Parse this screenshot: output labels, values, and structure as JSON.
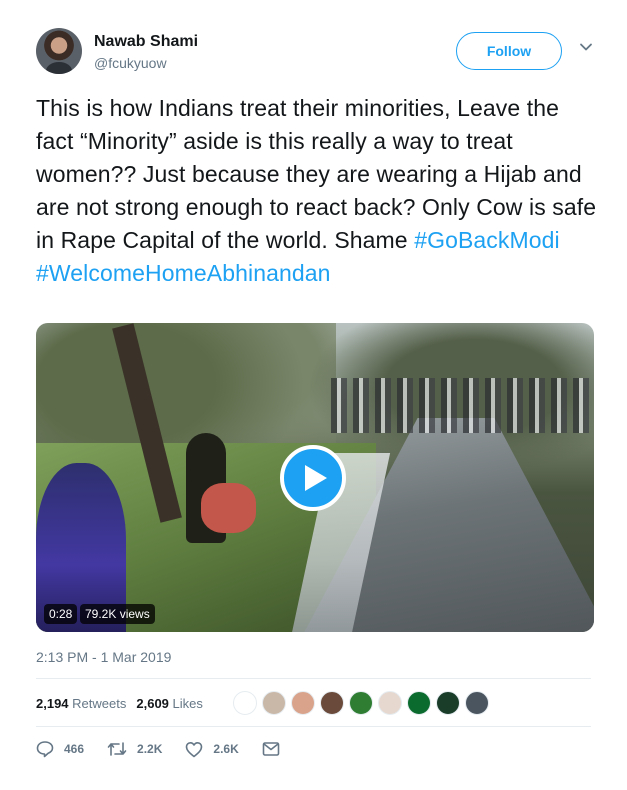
{
  "user": {
    "name": "Nawab Shami",
    "handle": "@fcukyuow",
    "follow_label": "Follow"
  },
  "tweet": {
    "text": "This is how Indians treat their minorities, Leave the fact “Minority” aside is this really a way to treat women?? Just because they are wearing a Hijab and are not strong enough to react back? Only Cow is safe in Rape Capital of the world. Shame ",
    "hashtags": [
      "#GoBackModi",
      "#WelcomeHomeAbhinandan"
    ],
    "timestamp": "2:13 PM - 1 Mar 2019"
  },
  "video": {
    "duration": "0:28",
    "views": "79.2K views"
  },
  "stats": {
    "retweets_count": "2,194",
    "retweets_label": "Retweets",
    "likes_count": "2,609",
    "likes_label": "Likes"
  },
  "likers": [
    {
      "icon": "emblem-avatar",
      "color": "#ffffff"
    },
    {
      "icon": "group-photo-avatar",
      "color": "#c9b8a8"
    },
    {
      "icon": "person-avatar",
      "color": "#d9a38b"
    },
    {
      "icon": "person-avatar",
      "color": "#6a4a3a"
    },
    {
      "icon": "emblem-green-avatar",
      "color": "#2e7d32"
    },
    {
      "icon": "person-avatar",
      "color": "#e6d8cf"
    },
    {
      "icon": "pakistan-flag-avatar",
      "color": "#0b6b2e"
    },
    {
      "icon": "dark-logo-avatar",
      "color": "#1a3d2a"
    },
    {
      "icon": "person-avatar",
      "color": "#4a5560"
    }
  ],
  "actions": {
    "replies": "466",
    "retweets": "2.2K",
    "likes": "2.6K"
  },
  "colors": {
    "accent": "#1da1f2",
    "muted": "#657786",
    "text": "#14171a"
  }
}
